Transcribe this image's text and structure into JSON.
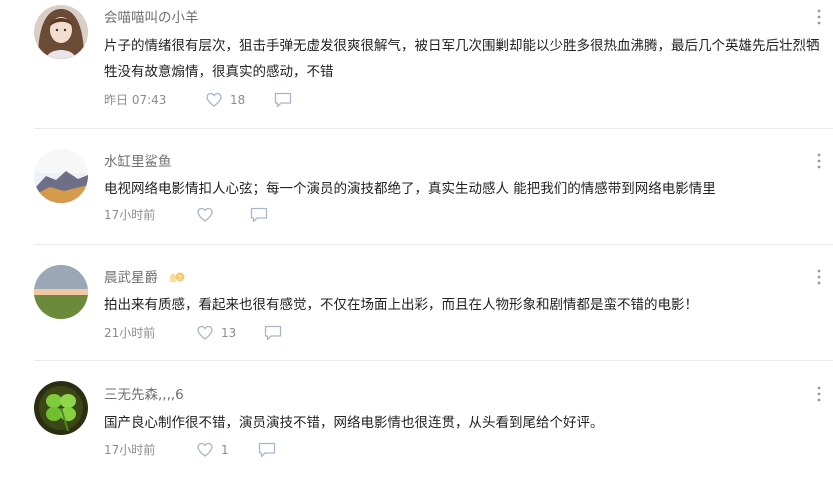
{
  "comments": [
    {
      "username": "会喵喵叫の小羊",
      "text": "片子的情绪很有层次，狙击手弹无虚发很爽很解气，被日军几次围剿却能以少胜多很热血沸腾，最后几个英雄先后壮烈牺牲没有故意煽情，很真实的感动，不错",
      "time": "昨日 07:43",
      "likes": "18"
    },
    {
      "username": "水缸里鲨鱼",
      "text": "电视网络电影情扣人心弦；每一个演员的演技都绝了，真实生动感人 能把我们的情感带到网络电影情里",
      "time": "17小时前",
      "likes": ""
    },
    {
      "username": "晨武星爵",
      "text": "拍出来有质感，看起来也很有感觉，不仅在场面上出彩，而且在人物形象和剧情都是蛮不错的电影！",
      "time": "21小时前",
      "likes": "13"
    },
    {
      "username": "三无先森,,,,6",
      "text": "国产良心制作很不错，演员演技不错，网络电影情也很连贯，从头看到尾给个好评。",
      "time": "17小时前",
      "likes": "1"
    }
  ]
}
